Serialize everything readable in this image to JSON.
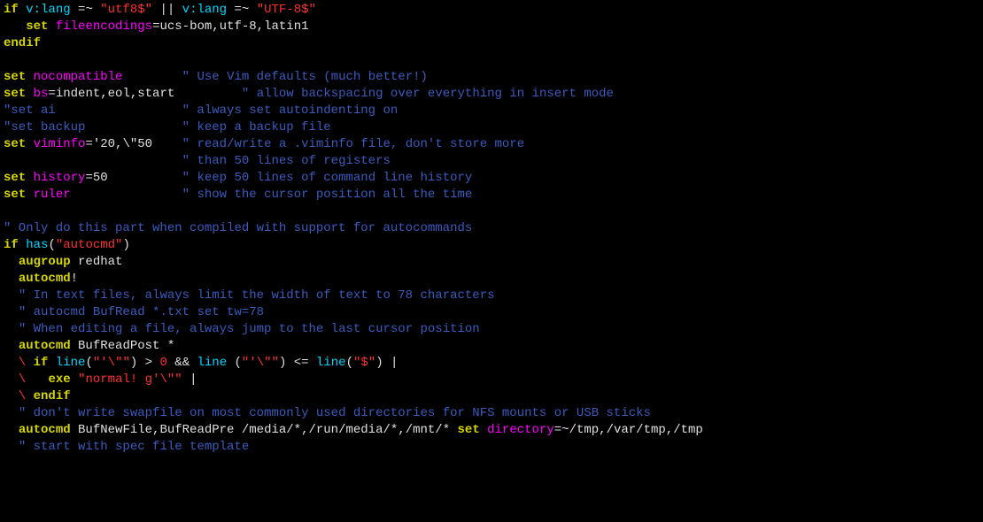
{
  "code": [
    [
      {
        "c": "kw",
        "t": "if"
      },
      {
        "c": "op",
        "t": " "
      },
      {
        "c": "id",
        "t": "v:lang"
      },
      {
        "c": "op",
        "t": " =~ "
      },
      {
        "c": "str",
        "t": "\"utf8$\""
      },
      {
        "c": "op",
        "t": " || "
      },
      {
        "c": "id",
        "t": "v:lang"
      },
      {
        "c": "op",
        "t": " =~ "
      },
      {
        "c": "str",
        "t": "\"UTF-8$\""
      }
    ],
    [
      {
        "c": "op",
        "t": "   "
      },
      {
        "c": "kw",
        "t": "set"
      },
      {
        "c": "op",
        "t": " "
      },
      {
        "c": "opt",
        "t": "fileencodings"
      },
      {
        "c": "op",
        "t": "="
      },
      {
        "c": "val",
        "t": "ucs-bom,utf-8,latin1"
      }
    ],
    [
      {
        "c": "kw",
        "t": "endif"
      }
    ],
    [
      {
        "c": "op",
        "t": ""
      }
    ],
    [
      {
        "c": "kw",
        "t": "set"
      },
      {
        "c": "op",
        "t": " "
      },
      {
        "c": "opt",
        "t": "nocompatible"
      },
      {
        "c": "op",
        "t": "        "
      },
      {
        "c": "cmt",
        "t": "\" Use Vim defaults (much better!)"
      }
    ],
    [
      {
        "c": "kw",
        "t": "set"
      },
      {
        "c": "op",
        "t": " "
      },
      {
        "c": "opt",
        "t": "bs"
      },
      {
        "c": "op",
        "t": "="
      },
      {
        "c": "val",
        "t": "indent,eol,start"
      },
      {
        "c": "op",
        "t": "         "
      },
      {
        "c": "cmt",
        "t": "\" allow backspacing over everything in insert mode"
      }
    ],
    [
      {
        "c": "cmt",
        "t": "\"set ai                 \" always set autoindenting on"
      }
    ],
    [
      {
        "c": "cmt",
        "t": "\"set backup             \" keep a backup file"
      }
    ],
    [
      {
        "c": "kw",
        "t": "set"
      },
      {
        "c": "op",
        "t": " "
      },
      {
        "c": "opt",
        "t": "viminfo"
      },
      {
        "c": "op",
        "t": "="
      },
      {
        "c": "val",
        "t": "'20,\\\"50"
      },
      {
        "c": "op",
        "t": "    "
      },
      {
        "c": "cmt",
        "t": "\" read/write a .viminfo file, don't store more"
      }
    ],
    [
      {
        "c": "op",
        "t": "                        "
      },
      {
        "c": "cmt",
        "t": "\" than 50 lines of registers"
      }
    ],
    [
      {
        "c": "kw",
        "t": "set"
      },
      {
        "c": "op",
        "t": " "
      },
      {
        "c": "opt",
        "t": "history"
      },
      {
        "c": "op",
        "t": "="
      },
      {
        "c": "val",
        "t": "50"
      },
      {
        "c": "op",
        "t": "          "
      },
      {
        "c": "cmt",
        "t": "\" keep 50 lines of command line history"
      }
    ],
    [
      {
        "c": "kw",
        "t": "set"
      },
      {
        "c": "op",
        "t": " "
      },
      {
        "c": "opt",
        "t": "ruler"
      },
      {
        "c": "op",
        "t": "               "
      },
      {
        "c": "cmt",
        "t": "\" show the cursor position all the time"
      }
    ],
    [
      {
        "c": "op",
        "t": ""
      }
    ],
    [
      {
        "c": "cmt",
        "t": "\" Only do this part when compiled with support for autocommands"
      }
    ],
    [
      {
        "c": "kw",
        "t": "if"
      },
      {
        "c": "op",
        "t": " "
      },
      {
        "c": "fn",
        "t": "has"
      },
      {
        "c": "op",
        "t": "("
      },
      {
        "c": "str",
        "t": "\"autocmd\""
      },
      {
        "c": "op",
        "t": ")"
      }
    ],
    [
      {
        "c": "op",
        "t": "  "
      },
      {
        "c": "kw",
        "t": "augroup"
      },
      {
        "c": "op",
        "t": " "
      },
      {
        "c": "val",
        "t": "redhat"
      }
    ],
    [
      {
        "c": "op",
        "t": "  "
      },
      {
        "c": "kw",
        "t": "autocmd"
      },
      {
        "c": "op",
        "t": "!"
      }
    ],
    [
      {
        "c": "op",
        "t": "  "
      },
      {
        "c": "cmt",
        "t": "\" In text files, always limit the width of text to 78 characters"
      }
    ],
    [
      {
        "c": "op",
        "t": "  "
      },
      {
        "c": "cmt",
        "t": "\" autocmd BufRead *.txt set tw=78"
      }
    ],
    [
      {
        "c": "op",
        "t": "  "
      },
      {
        "c": "cmt",
        "t": "\" When editing a file, always jump to the last cursor position"
      }
    ],
    [
      {
        "c": "op",
        "t": "  "
      },
      {
        "c": "kw",
        "t": "autocmd"
      },
      {
        "c": "op",
        "t": " "
      },
      {
        "c": "val",
        "t": "BufReadPost *"
      }
    ],
    [
      {
        "c": "op",
        "t": "  "
      },
      {
        "c": "esc",
        "t": "\\"
      },
      {
        "c": "op",
        "t": " "
      },
      {
        "c": "kw",
        "t": "if"
      },
      {
        "c": "op",
        "t": " "
      },
      {
        "c": "fn",
        "t": "line"
      },
      {
        "c": "op",
        "t": "("
      },
      {
        "c": "str",
        "t": "\"'\\\"\""
      },
      {
        "c": "op",
        "t": ") > "
      },
      {
        "c": "num",
        "t": "0"
      },
      {
        "c": "op",
        "t": " && "
      },
      {
        "c": "fn",
        "t": "line"
      },
      {
        "c": "op",
        "t": " ("
      },
      {
        "c": "str",
        "t": "\"'\\\"\""
      },
      {
        "c": "op",
        "t": ") <= "
      },
      {
        "c": "fn",
        "t": "line"
      },
      {
        "c": "op",
        "t": "("
      },
      {
        "c": "str",
        "t": "\"$\""
      },
      {
        "c": "op",
        "t": ") |"
      }
    ],
    [
      {
        "c": "op",
        "t": "  "
      },
      {
        "c": "esc",
        "t": "\\"
      },
      {
        "c": "op",
        "t": "   "
      },
      {
        "c": "kw",
        "t": "exe"
      },
      {
        "c": "op",
        "t": " "
      },
      {
        "c": "str",
        "t": "\"normal! g'\\\"\""
      },
      {
        "c": "op",
        "t": " |"
      }
    ],
    [
      {
        "c": "op",
        "t": "  "
      },
      {
        "c": "esc",
        "t": "\\"
      },
      {
        "c": "op",
        "t": " "
      },
      {
        "c": "kw",
        "t": "endif"
      }
    ],
    [
      {
        "c": "op",
        "t": "  "
      },
      {
        "c": "cmt",
        "t": "\" don't write swapfile on most commonly used directories for NFS mounts or USB sticks"
      }
    ],
    [
      {
        "c": "op",
        "t": "  "
      },
      {
        "c": "kw",
        "t": "autocmd"
      },
      {
        "c": "op",
        "t": " "
      },
      {
        "c": "val",
        "t": "BufNewFile,BufReadPre /media/*,/run/media/*,/mnt/* "
      },
      {
        "c": "kw",
        "t": "set"
      },
      {
        "c": "op",
        "t": " "
      },
      {
        "c": "opt",
        "t": "directory"
      },
      {
        "c": "op",
        "t": "="
      },
      {
        "c": "val",
        "t": "~/tmp,/var/tmp,/tmp"
      }
    ],
    [
      {
        "c": "op",
        "t": "  "
      },
      {
        "c": "cmt",
        "t": "\" start with spec file template"
      }
    ]
  ]
}
